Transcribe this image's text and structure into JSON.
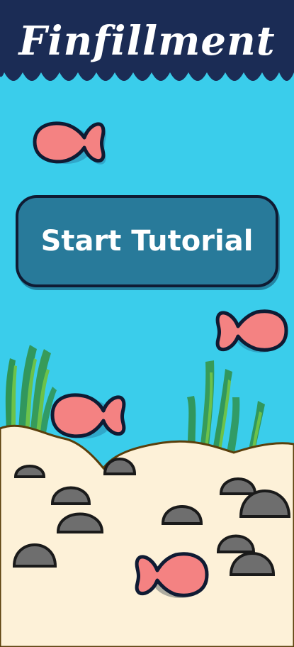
{
  "app": {
    "title": "Finfillment"
  },
  "menu": {
    "start_label": "Start Tutorial"
  },
  "colors": {
    "water": "#3acdeb",
    "header": "#1b2c55",
    "sand": "#fdf1d8",
    "sand_edge": "#5a3f0b",
    "button_fill": "#287a9a",
    "button_border": "#0f1b33",
    "fish_body": "#f48282",
    "fish_outline": "#0f1b33",
    "rock": "#6e6e6e",
    "seaweed_dark": "#2f8a3a",
    "seaweed_light": "#6cc24a"
  },
  "icons": {
    "fish": "fish-icon",
    "rock": "rock-icon",
    "seaweed": "seaweed-icon"
  }
}
